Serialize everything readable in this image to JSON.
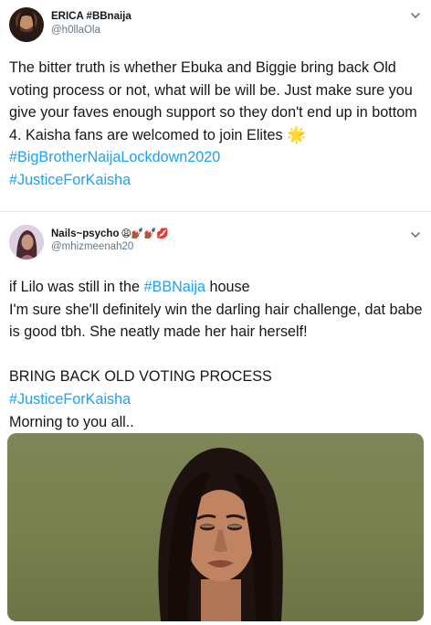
{
  "tweet1": {
    "display_name": "ERICA #BBnaija",
    "handle": "@h0llaOla",
    "text_plain": "The bitter truth is whether Ebuka and Biggie bring back Old voting process or not, what will be will be. Just make sure you give your faves enough support so they don't end up in bottom 4. Kaisha fans are welcomed to join Elites",
    "star_emoji": "🌟",
    "hashtag1": "#BigBrotherNaijaLockdown2020",
    "hashtag2": "#JusticeForKaisha",
    "avatar_icon": "profile-photo-icon",
    "menu_icon": "chevron-down-icon"
  },
  "tweet2": {
    "display_name": "Nails~psycho",
    "name_emojis": "😩💅🏾💅🏾💋",
    "handle": "@mhizmeenah20",
    "line1_prefix": "if Lilo was still in the ",
    "line1_hashtag": "#BBNaija",
    "line1_suffix": " house",
    "line2": "I'm sure she'll definitely win the darling hair challenge, dat babe is good tbh. She neatly made her hair herself!",
    "line3": "BRING BACK OLD VOTING PROCESS",
    "line4_hashtag": "#JusticeForKaisha",
    "line5": "Morning to you all..",
    "avatar_icon": "profile-photo-icon",
    "menu_icon": "chevron-down-icon",
    "photo": "portrait-photo"
  },
  "colors": {
    "link": "#1da1f2",
    "text": "#14171a",
    "secondary": "#657786",
    "divider": "#e1e8ed",
    "photo_bg": "#7a824f"
  }
}
